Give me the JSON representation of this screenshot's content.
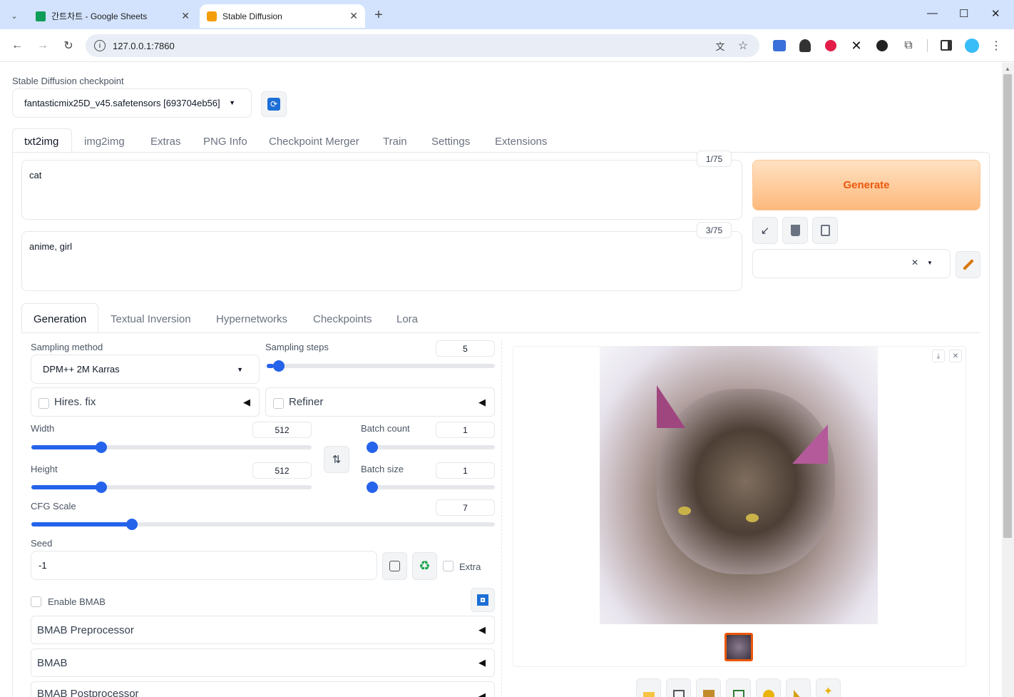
{
  "browser": {
    "tabs": [
      {
        "label": "간트차트 - Google Sheets",
        "active": false
      },
      {
        "label": "Stable Diffusion",
        "active": true
      }
    ],
    "new_tab_symbol": "+",
    "url": "127.0.0.1:7860",
    "window_controls": {
      "minimize": "—",
      "maximize": "☐",
      "close": "✕"
    }
  },
  "checkpoint": {
    "label": "Stable Diffusion checkpoint",
    "value": "fantasticmix25D_v45.safetensors [693704eb56]"
  },
  "main_tabs": [
    "txt2img",
    "img2img",
    "Extras",
    "PNG Info",
    "Checkpoint Merger",
    "Train",
    "Settings",
    "Extensions"
  ],
  "prompt": {
    "value": "cat",
    "counter": "1/75"
  },
  "negative_prompt": {
    "value": "anime, girl",
    "counter": "3/75"
  },
  "generate_label": "Generate",
  "sub_tabs": [
    "Generation",
    "Textual Inversion",
    "Hypernetworks",
    "Checkpoints",
    "Lora"
  ],
  "sampling": {
    "method_label": "Sampling method",
    "method_value": "DPM++ 2M Karras",
    "steps_label": "Sampling steps",
    "steps_value": "5",
    "steps_fraction": 0.03
  },
  "hires_label": "Hires. fix",
  "refiner_label": "Refiner",
  "width": {
    "label": "Width",
    "value": "512",
    "fraction": 0.24
  },
  "height": {
    "label": "Height",
    "value": "512",
    "fraction": 0.24
  },
  "batch_count": {
    "label": "Batch count",
    "value": "1",
    "fraction": 0.0
  },
  "batch_size": {
    "label": "Batch size",
    "value": "1",
    "fraction": 0.0
  },
  "cfg": {
    "label": "CFG Scale",
    "value": "7",
    "fraction": 0.21
  },
  "seed": {
    "label": "Seed",
    "value": "-1",
    "extra_label": "Extra"
  },
  "bmab": {
    "enable_label": "Enable BMAB",
    "sections": [
      "BMAB Preprocessor",
      "BMAB",
      "BMAB Postprocessor"
    ]
  },
  "colors": {
    "accent": "#2563eb",
    "generate_bg": "#fdba74",
    "generate_text": "#ea580c",
    "chrome": "#d3e3fd"
  }
}
